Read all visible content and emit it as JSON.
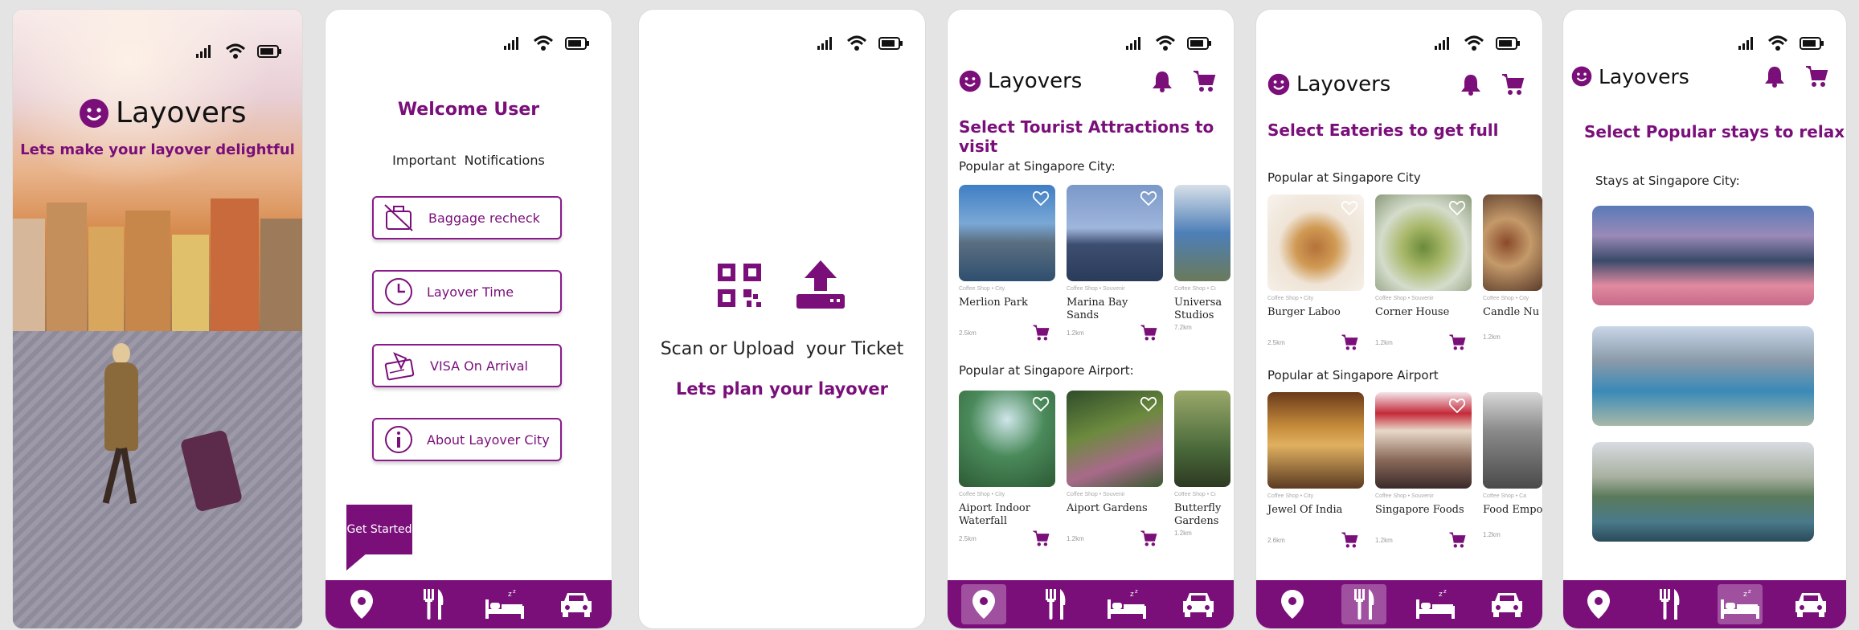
{
  "splash": {
    "app_name": "Layovers",
    "tagline": "Lets make your layover delightful"
  },
  "notifications": {
    "title": "Welcome User",
    "subtitle": "Important  Notifications",
    "items": [
      {
        "label": "Baggage recheck",
        "icon": "baggage-icon"
      },
      {
        "label": "Layover Time",
        "icon": "clock-icon"
      },
      {
        "label": "VISA On Arrival",
        "icon": "visa-icon"
      },
      {
        "label": "About Layover City",
        "icon": "info-icon"
      }
    ],
    "get_started": "Get Started"
  },
  "scan": {
    "instruction": "Scan or Upload  your Ticket",
    "cta": "Lets plan your layover"
  },
  "attractions": {
    "app_name": "Layovers",
    "title": "Select Tourist Attractions to visit",
    "section1": "Popular at Singapore City:",
    "section2": "Popular at Singapore Airport:",
    "city": [
      {
        "name": "Merlion Park",
        "meta": "Coffee Shop  •  City",
        "dist": "2.5km"
      },
      {
        "name": "Marina Bay Sands",
        "meta": "Coffee Shop  •  Souvenir",
        "dist": "1.2km"
      },
      {
        "name": "Universa Studios",
        "meta": "Coffee Shop  •  Ci",
        "dist": "7.2km"
      }
    ],
    "airport": [
      {
        "name": "Aiport Indoor Waterfall",
        "meta": "Coffee Shop  •  City",
        "dist": "2.5km"
      },
      {
        "name": "Aiport Gardens",
        "meta": "Coffee Shop  •  Souvenir",
        "dist": "1.2km"
      },
      {
        "name": "Butterfly Gardens",
        "meta": "Coffee Shop  •  Ci",
        "dist": "1.2km"
      }
    ]
  },
  "eateries": {
    "app_name": "Layovers",
    "title": "Select Eateries to get full",
    "section1": "Popular at Singapore City",
    "section2": "Popular at Singapore Airport",
    "city": [
      {
        "name": "Burger Laboo",
        "meta": "Coffee Shop  •  City",
        "dist": "2.5km"
      },
      {
        "name": "Corner House",
        "meta": "Coffee Shop  •  Souvenir",
        "dist": "1.2km"
      },
      {
        "name": "Candle Nu",
        "meta": "Coffee Shop  •  City",
        "dist": "1.2km"
      }
    ],
    "airport": [
      {
        "name": "Jewel Of India",
        "meta": "Coffee Shop  •  City",
        "dist": "2.6km"
      },
      {
        "name": "Singapore Foods",
        "meta": "Coffee Shop  •  Souvenir",
        "dist": "1.2km"
      },
      {
        "name": "Food Empo",
        "meta": "Coffee Shop  •  Ca",
        "dist": "1.2km"
      }
    ]
  },
  "stays": {
    "app_name": "Layovers",
    "title": "Select Popular stays to relax",
    "section1": "Stays at Singapore City:"
  },
  "colors": {
    "brand": "#7a0f7a",
    "nav_bar": "#7a0f7a",
    "background": "#e4e4e4"
  }
}
